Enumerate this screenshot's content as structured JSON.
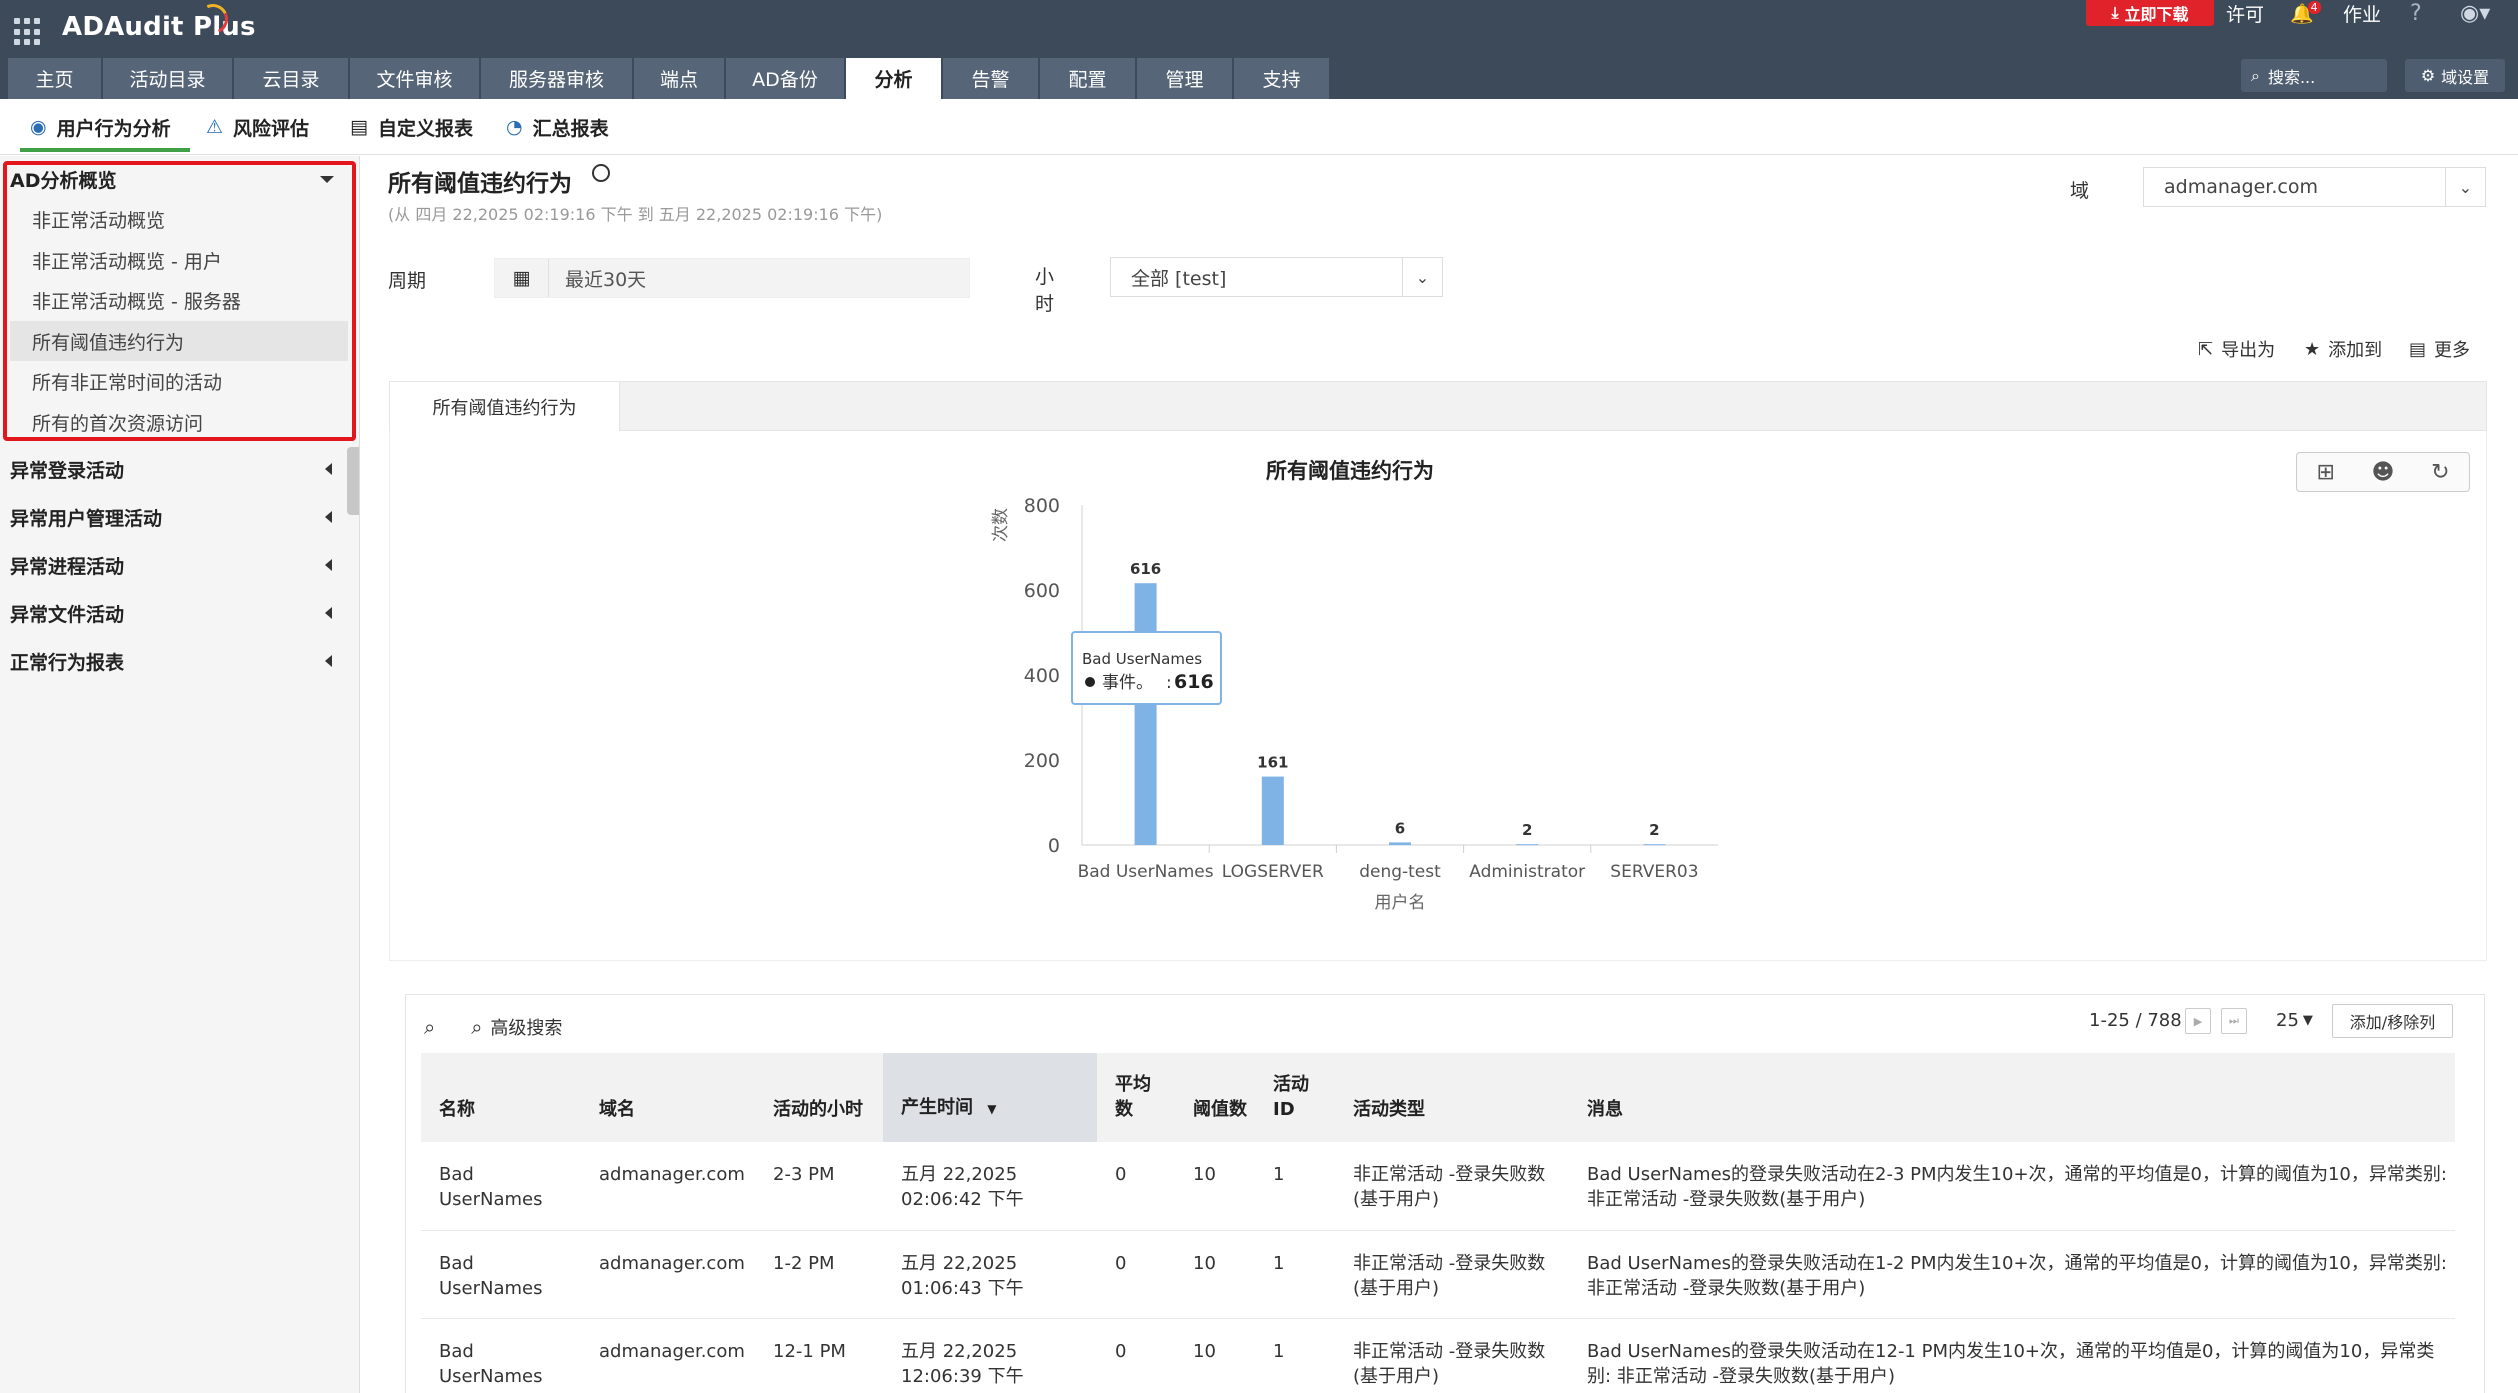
{
  "app": {
    "name": "ADAudit Plus"
  },
  "topright": {
    "download": "立即下载",
    "license": "许可",
    "notif_count": "4",
    "jobs": "作业",
    "help": "?"
  },
  "nav": {
    "items": [
      "主页",
      "活动目录",
      "云目录",
      "文件审核",
      "服务器审核",
      "端点",
      "AD备份",
      "分析",
      "告警",
      "配置",
      "管理",
      "支持"
    ],
    "active": "分析",
    "search_placeholder": "搜索...",
    "domain_settings": "域设置"
  },
  "subnav": {
    "tabs": [
      "用户行为分析",
      "风险评估",
      "自定义报表",
      "汇总报表"
    ]
  },
  "sidebar": {
    "group_overview": "AD分析概览",
    "items": [
      "非正常活动概览",
      "非正常活动概览 - 用户",
      "非正常活动概览 - 服务器",
      "所有阈值违约行为",
      "所有非正常时间的活动",
      "所有的首次资源访问"
    ],
    "selected": "所有阈值违约行为",
    "groups": [
      "异常登录活动",
      "异常用户管理活动",
      "异常进程活动",
      "异常文件活动",
      "正常行为报表"
    ]
  },
  "report": {
    "title": "所有阈值违约行为",
    "subtitle": "(从 四月 22,2025 02:19:16 下午 到 五月 22,2025 02:19:16 下午)",
    "domain_label": "域",
    "domain_value": "admanager.com",
    "period_label": "周期",
    "period_value": "最近30天",
    "hour_label": "小时",
    "hour_value": "全部 [test]",
    "export": "导出为",
    "add_to": "添加到",
    "more": "更多",
    "tab": "所有阈值违约行为"
  },
  "chart_data": {
    "type": "bar",
    "title": "所有阈值违约行为",
    "xlabel": "用户名",
    "ylabel": "次数",
    "categories": [
      "Bad UserNames",
      "LOGSERVER",
      "deng-test",
      "Administrator",
      "SERVER03"
    ],
    "values": [
      616,
      161,
      6,
      2,
      2
    ],
    "ylim": [
      0,
      800
    ],
    "yticks": [
      0,
      200,
      400,
      600,
      800
    ],
    "color": "#7fb2e5",
    "tooltip": {
      "title": "Bad UserNames",
      "label": "事件。",
      "value": "616"
    }
  },
  "table": {
    "adv_search": "高级搜索",
    "range": "1-25 / 788",
    "page_size": "25",
    "add_remove": "添加/移除列",
    "columns": [
      "名称",
      "域名",
      "活动的小时",
      "产生时间",
      "平均数",
      "阈值数",
      "活动ID",
      "活动类型",
      "消息"
    ],
    "rows": [
      [
        "Bad UserNames",
        "admanager.com",
        "2-3 PM",
        "五月 22,2025 02:06:42 下午",
        "0",
        "10",
        "1",
        "非正常活动 -登录失败数(基于用户)",
        "Bad UserNames的登录失败活动在2-3 PM内发生10+次，通常的平均值是0，计算的阈值为10，异常类别: 非正常活动 -登录失败数(基于用户)"
      ],
      [
        "Bad UserNames",
        "admanager.com",
        "1-2 PM",
        "五月 22,2025 01:06:43 下午",
        "0",
        "10",
        "1",
        "非正常活动 -登录失败数(基于用户)",
        "Bad UserNames的登录失败活动在1-2 PM内发生10+次，通常的平均值是0，计算的阈值为10，异常类别: 非正常活动 -登录失败数(基于用户)"
      ],
      [
        "Bad UserNames",
        "admanager.com",
        "12-1 PM",
        "五月 22,2025 12:06:39 下午",
        "0",
        "10",
        "1",
        "非正常活动 -登录失败数(基于用户)",
        "Bad UserNames的登录失败活动在12-1 PM内发生10+次，通常的平均值是0，计算的阈值为10，异常类别: 非正常活动 -登录失败数(基于用户)"
      ]
    ]
  }
}
